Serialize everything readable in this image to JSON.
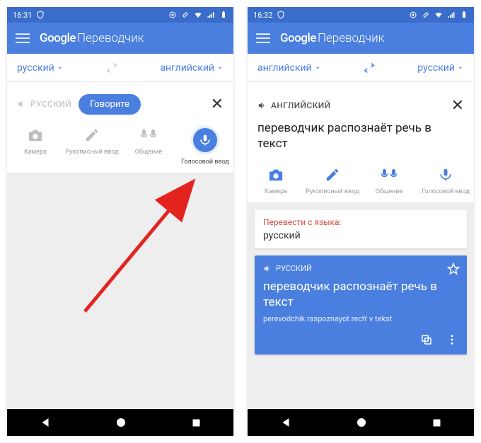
{
  "left": {
    "status_time": "16:31",
    "app_title_google": "Google",
    "app_title_sub": "Переводчик",
    "lang_from": "русский",
    "lang_to": "английский",
    "src_label": "РУССКИЙ",
    "speak_label": "Говорите",
    "tools": {
      "camera": "Камера",
      "handwrite": "Рукописный ввод",
      "conversation": "Общение",
      "voice": "Голосовой ввод"
    }
  },
  "right": {
    "status_time": "16:32",
    "app_title_google": "Google",
    "app_title_sub": "Переводчик",
    "lang_from": "английский",
    "lang_to": "русский",
    "src_label": "АНГЛИЙСКИЙ",
    "input_text": "переводчик распознаёт речь в текст",
    "tools": {
      "camera": "Камера",
      "handwrite": "Рукописный ввод",
      "conversation": "Общение",
      "voice": "Голосовой ввод"
    },
    "detect_hdr": "Перевести с языка:",
    "detect_val": "русский",
    "result_src": "РУССКИЙ",
    "result_text": "переводчик распознаёт речь в текст",
    "result_translit": "perevodchik raspoznayot rech' v tekst"
  }
}
